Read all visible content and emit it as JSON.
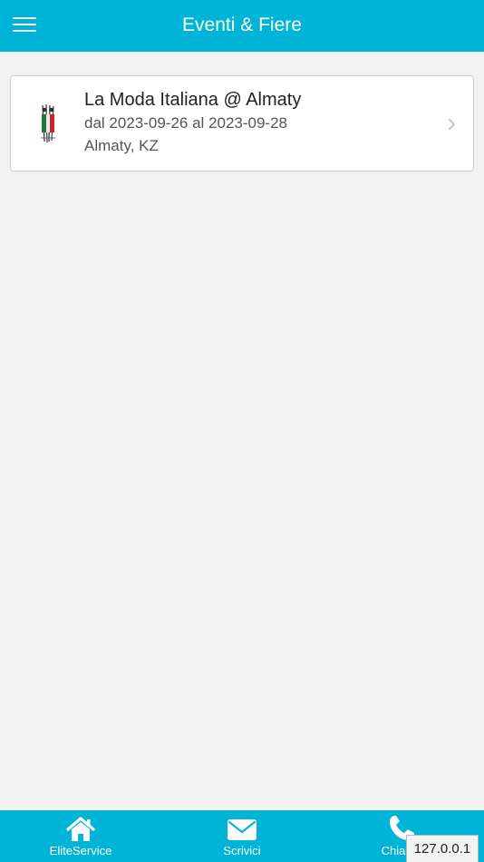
{
  "header": {
    "title": "Eventi & Fiere",
    "menu_icon": "hamburger-menu-icon"
  },
  "events": [
    {
      "title": "La Moda Italiana @ Almaty",
      "dates": "dal 2023-09-26 al 2023-09-28",
      "location": "Almaty, KZ",
      "thumbnail_icon": "event-logo-icon",
      "arrow_icon": "chevron-right-icon"
    }
  ],
  "tabbar": {
    "items": [
      {
        "label": "EliteService",
        "icon": "home-icon"
      },
      {
        "label": "Scrivici",
        "icon": "envelope-icon"
      },
      {
        "label": "Chiama",
        "icon": "phone-icon"
      }
    ]
  },
  "overlay": {
    "ip": "127.0.0.1"
  },
  "colors": {
    "primary": "#00b4d8",
    "background": "#f2f2f2",
    "card": "#ffffff",
    "text_dark": "#222222",
    "text_muted": "#555555"
  }
}
